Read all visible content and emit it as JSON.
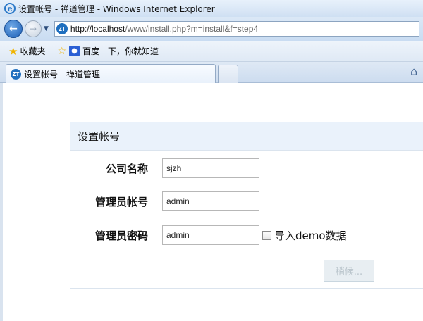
{
  "window": {
    "title": "设置帐号 - 禅道管理 - Windows Internet Explorer"
  },
  "address": {
    "icon_text": "ZT",
    "host": "http://localhost",
    "path": "/www/install.php?m=install&f=step4"
  },
  "favorites": {
    "label": "收藏夹",
    "link_label": "百度一下，你就知道"
  },
  "tab": {
    "label": "设置帐号 - 禅道管理",
    "icon_text": "ZT"
  },
  "form": {
    "title": "设置帐号",
    "company_label": "公司名称",
    "company_value": "sjzh",
    "account_label": "管理员帐号",
    "account_value": "admin",
    "password_label": "管理员密码",
    "password_value": "admin",
    "demo_label": "导入demo数据",
    "submit_label": "稍候..."
  },
  "icons": {
    "back": "back-arrow-icon",
    "forward": "forward-arrow-icon",
    "favorites": "star-icon",
    "add_favorite": "add-favorite-icon",
    "baidu": "baidu-paw-icon",
    "home": "home-icon",
    "ie": "ie-logo-icon"
  },
  "colors": {
    "panel_header": "#eaf2fb",
    "titlebar": "#cfe0f3"
  }
}
